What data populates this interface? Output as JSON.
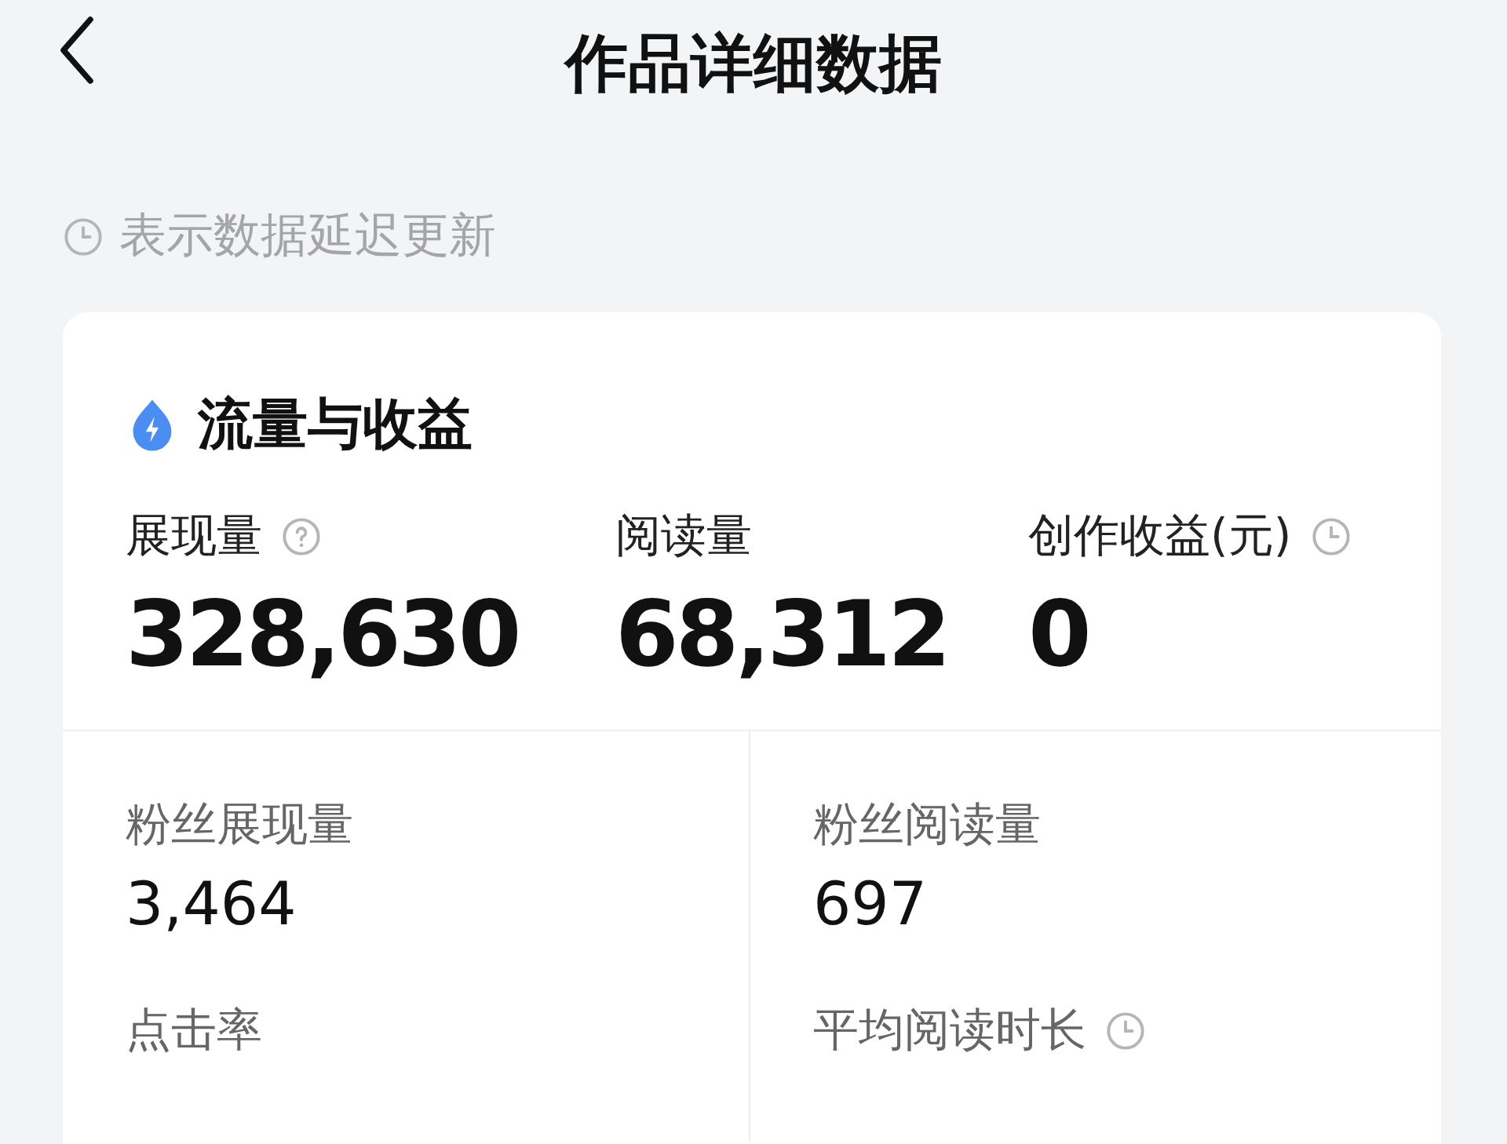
{
  "header": {
    "title": "作品详细数据"
  },
  "note": {
    "text": "表示数据延迟更新"
  },
  "card": {
    "title": "流量与收益",
    "metrics": [
      {
        "label": "展现量",
        "value": "328,630",
        "kind": "help"
      },
      {
        "label": "阅读量",
        "value": "68,312",
        "kind": "plain"
      },
      {
        "label": "创作收益(元)",
        "value": "0",
        "kind": "delayed"
      }
    ],
    "details": [
      {
        "label": "粉丝展现量",
        "value": "3,464",
        "kind": "plain"
      },
      {
        "label": "粉丝阅读量",
        "value": "697",
        "kind": "plain"
      },
      {
        "label": "点击率",
        "kind": "plain"
      },
      {
        "label": "平均阅读时长",
        "kind": "delayed"
      }
    ]
  }
}
